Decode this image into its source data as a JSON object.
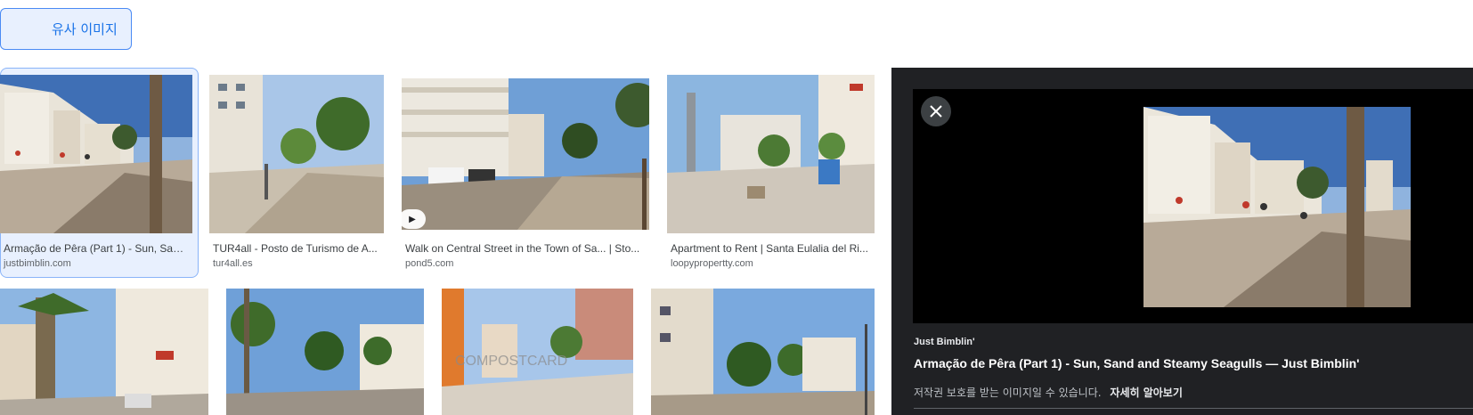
{
  "similar_button": {
    "label": "유사 이미지"
  },
  "results": [
    {
      "title": "Armação de Pêra (Part 1) - Sun, San...",
      "source": "justbimblin.com"
    },
    {
      "title": "TUR4all - Posto de Turismo de A...",
      "source": "tur4all.es"
    },
    {
      "title": "Walk on Central Street in the Town of Sa... | Sto...",
      "source": "pond5.com"
    },
    {
      "title": "Apartment to Rent | Santa Eulalia del Ri...",
      "source": "loopypropertty.com"
    }
  ],
  "watermark_text": "COMPOSTCARD",
  "panel": {
    "source": "Just Bimblin'",
    "title": "Armação de Pêra (Part 1) - Sun, Sand and Steamy Seagulls — Just Bimblin'",
    "notice": "저작권 보호를 받는 이미지일 수 있습니다.",
    "learn_more": "자세히 알아보기"
  },
  "colors": {
    "accent": "#1a73e8",
    "panel_bg": "#202124",
    "selected_bg": "#e8f0fe"
  }
}
